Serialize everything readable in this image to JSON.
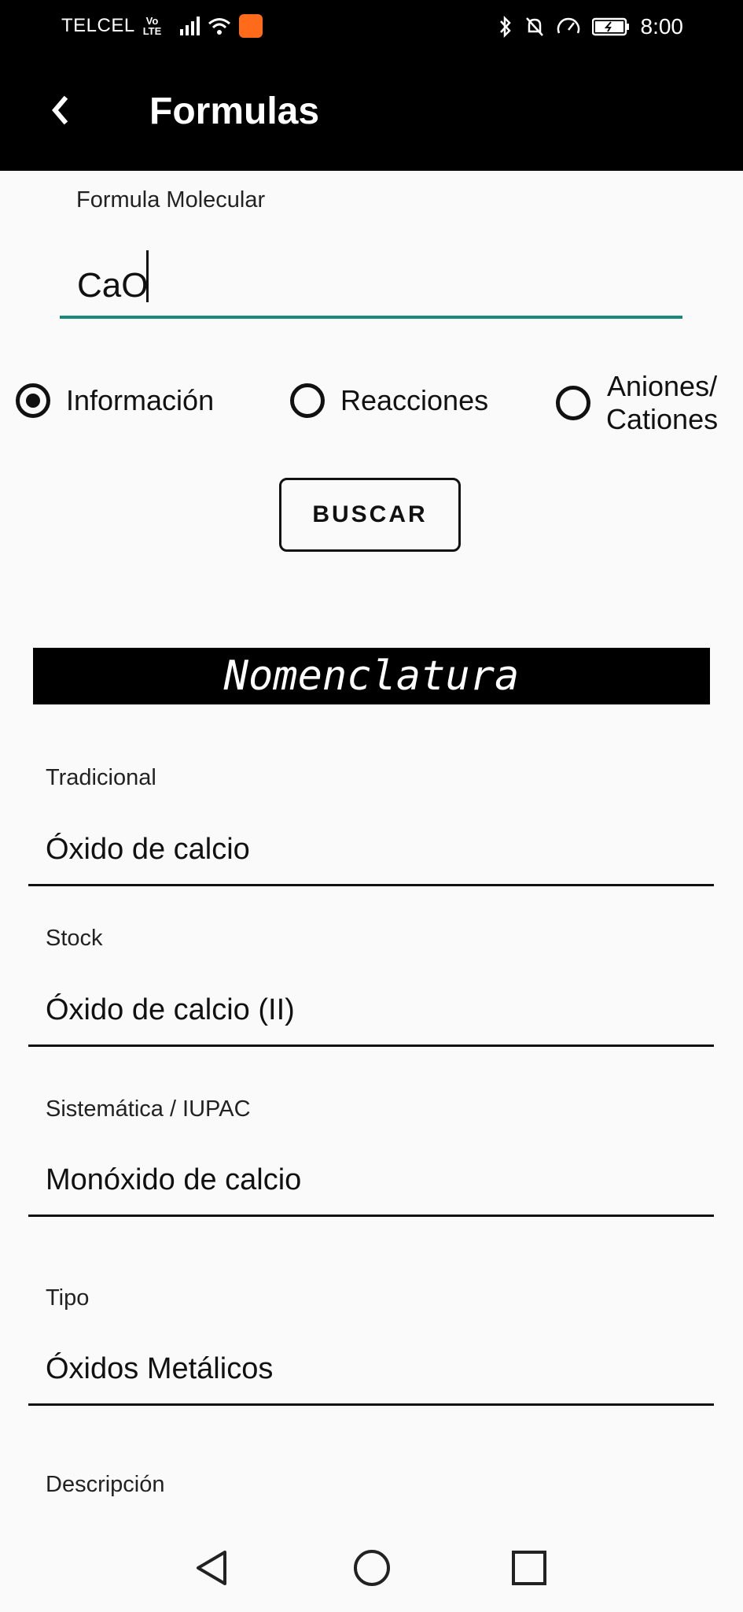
{
  "status_bar": {
    "carrier": "TELCEL",
    "volte_line1": "Vo",
    "volte_line2": "LTE",
    "time": "8:00"
  },
  "app_bar": {
    "title": "Formulas"
  },
  "search": {
    "label": "Formula Molecular",
    "value": "CaO",
    "radio_options": [
      {
        "label": "Información",
        "selected": true
      },
      {
        "label": "Reacciones",
        "selected": false
      },
      {
        "label_line1": "Aniones/",
        "label_line2": "Cationes",
        "selected": false
      }
    ],
    "button_label": "BUSCAR"
  },
  "results": {
    "section_title": "Nomenclatura",
    "fields": [
      {
        "label": "Tradicional",
        "value": "Óxido de calcio"
      },
      {
        "label": "Stock",
        "value": "Óxido de calcio (II)"
      },
      {
        "label": "Sistemática / IUPAC",
        "value": "Monóxido de calcio"
      },
      {
        "label": "Tipo",
        "value": "Óxidos Metálicos"
      },
      {
        "label": "Descripción",
        "value": ""
      }
    ]
  },
  "icons": {
    "back": "chevron-left-icon",
    "nav_back": "triangle-back-icon",
    "nav_home": "circle-home-icon",
    "nav_recents": "square-recents-icon"
  },
  "colors": {
    "accent": "#178a7a",
    "app_bar": "#000000",
    "background": "#fafafa"
  }
}
